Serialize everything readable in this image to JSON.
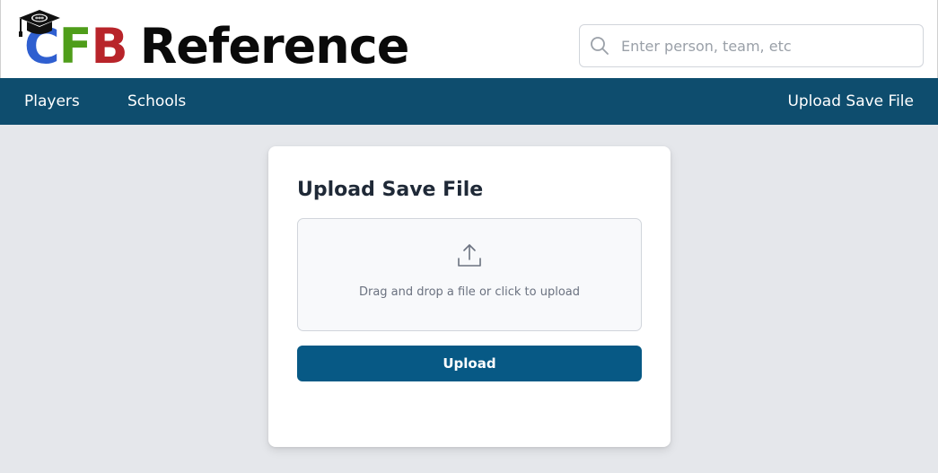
{
  "header": {
    "logo": {
      "letter_c": "C",
      "letter_f": "F",
      "letter_b": "B",
      "word": "Reference",
      "icon": "graduation-cap-football-icon",
      "colors": {
        "c": "#2f5fd0",
        "f": "#4f9d1a",
        "b": "#b8242a",
        "word": "#0a0a0a"
      }
    },
    "search": {
      "placeholder": "Enter person, team, etc",
      "value": "",
      "icon": "search-icon"
    }
  },
  "nav": {
    "background": "#0e4d6e",
    "items": [
      {
        "label": "Players"
      },
      {
        "label": "Schools"
      }
    ],
    "right_item": {
      "label": "Upload Save File"
    }
  },
  "card": {
    "title": "Upload Save File",
    "dropzone": {
      "icon": "upload-icon",
      "text": "Drag and drop a file or click to upload"
    },
    "button": {
      "label": "Upload",
      "color": "#075985"
    }
  },
  "page": {
    "background": "#e5e7eb"
  }
}
